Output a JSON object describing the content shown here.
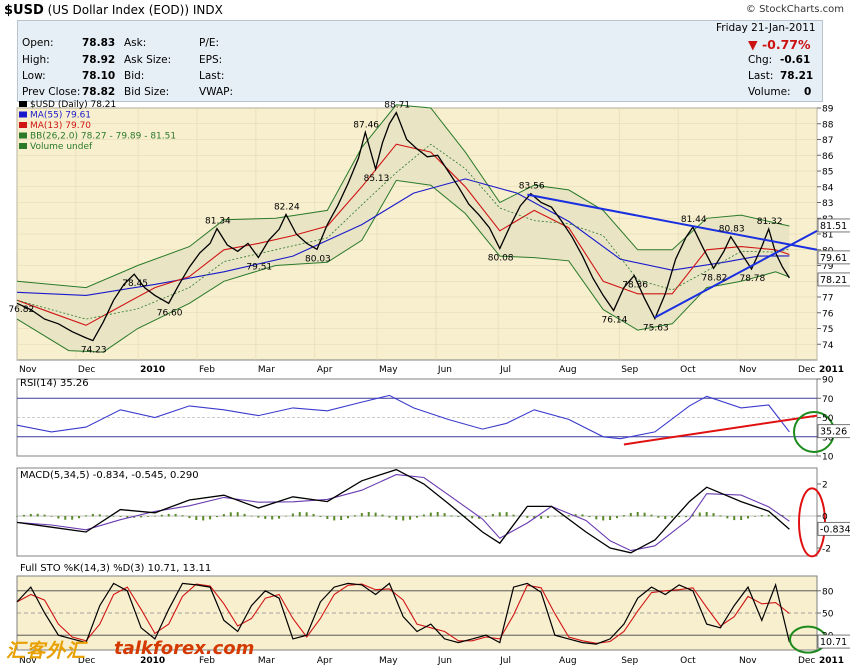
{
  "header": {
    "symbol": "$USD",
    "name": "(US Dollar Index (EOD))",
    "exchange": "INDX",
    "brand": "© StockCharts.com"
  },
  "quote": {
    "date": "Friday   21-Jan-2011",
    "pct_change": "▼ -0.77%",
    "open_label": "Open:",
    "open": "78.83",
    "high_label": "High:",
    "high": "78.92",
    "low_label": "Low:",
    "low": "78.10",
    "prev_label": "Prev Close:",
    "prev": "78.82",
    "ask_label": "Ask:",
    "asksize_label": "Ask Size:",
    "bid_label": "Bid:",
    "bidsize_label": "Bid Size:",
    "pe_label": "P/E:",
    "eps_label": "EPS:",
    "last_label": "Last:",
    "vwap_label": "VWAP:",
    "chg_label": "Chg:",
    "chg": "-0.61",
    "last2_label": "Last:",
    "last2": "78.21",
    "vol_label": "Volume:",
    "vol": "0"
  },
  "chart_data": [
    {
      "type": "line",
      "title": "$USD (Daily) 78.21",
      "legend": [
        "$USD (Daily) 78.21",
        "MA(55) 79.61",
        "MA(13) 79.70",
        "BB(26,2.0) 78.27 - 79.89 - 81.51",
        "Volume undef"
      ],
      "x": [
        "Nov",
        "Dec",
        "2010",
        "Feb",
        "Mar",
        "Apr",
        "May",
        "Jun",
        "Jul",
        "Aug",
        "Sep",
        "Oct",
        "Nov",
        "Dec",
        "2011"
      ],
      "ylim": [
        73,
        89
      ],
      "yticks": [
        74,
        75,
        76,
        77,
        78,
        79,
        80,
        81,
        82,
        83,
        84,
        85,
        86,
        87,
        88,
        89
      ],
      "price_path": [
        [
          0,
          76.6
        ],
        [
          4,
          76.2
        ],
        [
          8,
          75.6
        ],
        [
          12,
          75.3
        ],
        [
          16,
          74.8
        ],
        [
          20,
          74.4
        ],
        [
          22,
          74.23
        ],
        [
          25,
          75.4
        ],
        [
          28,
          76.8
        ],
        [
          31,
          77.8
        ],
        [
          34,
          78.45
        ],
        [
          37,
          77.6
        ],
        [
          40,
          77.1
        ],
        [
          44,
          76.6
        ],
        [
          47,
          77.8
        ],
        [
          50,
          78.9
        ],
        [
          53,
          79.8
        ],
        [
          56,
          80.4
        ],
        [
          58,
          81.34
        ],
        [
          61,
          80.3
        ],
        [
          64,
          79.9
        ],
        [
          67,
          80.4
        ],
        [
          70,
          79.51
        ],
        [
          73,
          80.6
        ],
        [
          76,
          81.3
        ],
        [
          78,
          82.24
        ],
        [
          81,
          81.0
        ],
        [
          84,
          80.4
        ],
        [
          87,
          80.03
        ],
        [
          90,
          81.6
        ],
        [
          93,
          82.8
        ],
        [
          96,
          84.2
        ],
        [
          99,
          85.8
        ],
        [
          101,
          87.46
        ],
        [
          104,
          85.13
        ],
        [
          106,
          86.8
        ],
        [
          108,
          88.0
        ],
        [
          110,
          88.71
        ],
        [
          113,
          87.0
        ],
        [
          116,
          86.4
        ],
        [
          119,
          85.9
        ],
        [
          122,
          86.0
        ],
        [
          125,
          85.0
        ],
        [
          128,
          84.0
        ],
        [
          131,
          82.9
        ],
        [
          134,
          82.2
        ],
        [
          137,
          81.4
        ],
        [
          140,
          80.08
        ],
        [
          143,
          81.5
        ],
        [
          146,
          82.8
        ],
        [
          149,
          83.56
        ],
        [
          152,
          83.0
        ],
        [
          155,
          82.7
        ],
        [
          158,
          81.8
        ],
        [
          161,
          80.8
        ],
        [
          164,
          79.6
        ],
        [
          167,
          78.2
        ],
        [
          170,
          77.1
        ],
        [
          173,
          76.14
        ],
        [
          176,
          77.6
        ],
        [
          179,
          78.36
        ],
        [
          182,
          76.9
        ],
        [
          185,
          75.63
        ],
        [
          188,
          77.2
        ],
        [
          191,
          79.4
        ],
        [
          194,
          80.8
        ],
        [
          196,
          81.44
        ],
        [
          199,
          80.1
        ],
        [
          202,
          78.82
        ],
        [
          205,
          79.9
        ],
        [
          207,
          80.83
        ],
        [
          210,
          79.8
        ],
        [
          213,
          78.78
        ],
        [
          216,
          80.2
        ],
        [
          218,
          81.32
        ],
        [
          220,
          79.8
        ],
        [
          222,
          78.9
        ],
        [
          224,
          78.21
        ]
      ],
      "ma55_path": [
        [
          0,
          77.3
        ],
        [
          20,
          77.1
        ],
        [
          40,
          77.8
        ],
        [
          60,
          78.6
        ],
        [
          80,
          79.6
        ],
        [
          100,
          81.6
        ],
        [
          115,
          83.6
        ],
        [
          130,
          84.5
        ],
        [
          145,
          83.6
        ],
        [
          160,
          81.8
        ],
        [
          175,
          79.4
        ],
        [
          190,
          78.7
        ],
        [
          205,
          79.2
        ],
        [
          215,
          79.6
        ],
        [
          224,
          79.61
        ]
      ],
      "ma13_path": [
        [
          0,
          76.8
        ],
        [
          10,
          76.0
        ],
        [
          20,
          75.2
        ],
        [
          30,
          76.4
        ],
        [
          40,
          77.6
        ],
        [
          50,
          78.3
        ],
        [
          60,
          80.0
        ],
        [
          70,
          80.4
        ],
        [
          80,
          80.9
        ],
        [
          90,
          81.5
        ],
        [
          100,
          84.0
        ],
        [
          110,
          86.7
        ],
        [
          120,
          86.2
        ],
        [
          130,
          84.0
        ],
        [
          140,
          81.2
        ],
        [
          150,
          82.5
        ],
        [
          160,
          81.4
        ],
        [
          170,
          78.0
        ],
        [
          180,
          77.2
        ],
        [
          190,
          77.2
        ],
        [
          200,
          80.0
        ],
        [
          210,
          80.2
        ],
        [
          220,
          80.0
        ],
        [
          224,
          79.7
        ]
      ],
      "bb_upper_path": [
        [
          0,
          78.0
        ],
        [
          20,
          77.6
        ],
        [
          35,
          79.0
        ],
        [
          50,
          80.2
        ],
        [
          60,
          81.9
        ],
        [
          75,
          82.0
        ],
        [
          90,
          82.5
        ],
        [
          100,
          86.5
        ],
        [
          110,
          89.2
        ],
        [
          120,
          89.0
        ],
        [
          130,
          86.2
        ],
        [
          140,
          83.0
        ],
        [
          150,
          84.1
        ],
        [
          160,
          83.8
        ],
        [
          170,
          82.5
        ],
        [
          180,
          80.0
        ],
        [
          190,
          80.0
        ],
        [
          200,
          82.0
        ],
        [
          210,
          82.2
        ],
        [
          220,
          81.7
        ],
        [
          224,
          81.51
        ]
      ],
      "bb_lower_path": [
        [
          0,
          75.6
        ],
        [
          15,
          73.6
        ],
        [
          25,
          73.5
        ],
        [
          35,
          75.0
        ],
        [
          50,
          76.6
        ],
        [
          60,
          78.0
        ],
        [
          75,
          79.0
        ],
        [
          90,
          79.2
        ],
        [
          100,
          80.6
        ],
        [
          110,
          84.4
        ],
        [
          120,
          84.1
        ],
        [
          130,
          82.3
        ],
        [
          140,
          79.6
        ],
        [
          150,
          79.5
        ],
        [
          160,
          79.3
        ],
        [
          170,
          76.2
        ],
        [
          180,
          74.9
        ],
        [
          190,
          75.3
        ],
        [
          200,
          77.6
        ],
        [
          210,
          78.0
        ],
        [
          220,
          78.6
        ],
        [
          224,
          78.27
        ]
      ],
      "annotations": [
        {
          "label": "76.82",
          "x": 1,
          "y": 76.82
        },
        {
          "label": "74.23",
          "x": 22,
          "y": 74.23
        },
        {
          "label": "78.45",
          "x": 34,
          "y": 78.45
        },
        {
          "label": "76.60",
          "x": 44,
          "y": 76.6
        },
        {
          "label": "81.34",
          "x": 58,
          "y": 81.34
        },
        {
          "label": "79.51",
          "x": 70,
          "y": 79.51
        },
        {
          "label": "82.24",
          "x": 78,
          "y": 82.24
        },
        {
          "label": "80.03",
          "x": 87,
          "y": 80.03
        },
        {
          "label": "87.46",
          "x": 101,
          "y": 87.46
        },
        {
          "label": "85.13",
          "x": 104,
          "y": 85.13
        },
        {
          "label": "88.71",
          "x": 110,
          "y": 88.71
        },
        {
          "label": "80.08",
          "x": 140,
          "y": 80.08
        },
        {
          "label": "83.56",
          "x": 149,
          "y": 83.56
        },
        {
          "label": "76.14",
          "x": 173,
          "y": 76.14
        },
        {
          "label": "78.36",
          "x": 179,
          "y": 78.36
        },
        {
          "label": "75.63",
          "x": 185,
          "y": 75.63
        },
        {
          "label": "81.44",
          "x": 196,
          "y": 81.44
        },
        {
          "label": "78.82",
          "x": 202,
          "y": 78.82
        },
        {
          "label": "80.83",
          "x": 207,
          "y": 80.83
        },
        {
          "label": "78.78",
          "x": 213,
          "y": 78.78
        },
        {
          "label": "81.32",
          "x": 218,
          "y": 81.32
        }
      ],
      "right_labels": [
        "81.51",
        "79.61",
        "78.21"
      ],
      "trendlines": [
        {
          "from": [
            148,
            83.5
          ],
          "to": [
            232,
            80.0
          ]
        },
        {
          "from": [
            185,
            75.7
          ],
          "to": [
            232,
            81.2
          ]
        }
      ]
    },
    {
      "type": "line",
      "title": "RSI(14) 35.26",
      "ylim": [
        10,
        90
      ],
      "yticks": [
        10,
        30,
        50,
        70,
        90
      ],
      "ref_lines": [
        30,
        70
      ],
      "last": "35.26",
      "path": [
        [
          0,
          42
        ],
        [
          10,
          35
        ],
        [
          20,
          40
        ],
        [
          30,
          58
        ],
        [
          40,
          50
        ],
        [
          50,
          62
        ],
        [
          60,
          58
        ],
        [
          70,
          52
        ],
        [
          80,
          60
        ],
        [
          90,
          57
        ],
        [
          100,
          66
        ],
        [
          108,
          73
        ],
        [
          115,
          60
        ],
        [
          125,
          48
        ],
        [
          135,
          38
        ],
        [
          142,
          44
        ],
        [
          150,
          58
        ],
        [
          160,
          48
        ],
        [
          170,
          30
        ],
        [
          175,
          28
        ],
        [
          185,
          35
        ],
        [
          195,
          62
        ],
        [
          200,
          72
        ],
        [
          210,
          60
        ],
        [
          218,
          63
        ],
        [
          224,
          35
        ]
      ],
      "trendline": {
        "from": [
          176,
          22
        ],
        "to": [
          232,
          52
        ]
      }
    },
    {
      "type": "line",
      "title": "MACD(5,34,5) -0.834, -0.545, 0.290",
      "series": [
        {
          "name": "MACD(5,34,5)"
        },
        {
          "name": "Signal"
        },
        {
          "name": "Histogram"
        }
      ],
      "ylim": [
        -2.5,
        3
      ],
      "yticks": [
        -2,
        0,
        2
      ],
      "last": "-0.834",
      "path": [
        [
          0,
          -0.4
        ],
        [
          10,
          -0.7
        ],
        [
          20,
          -1.0
        ],
        [
          30,
          0.4
        ],
        [
          40,
          0.2
        ],
        [
          50,
          1.0
        ],
        [
          60,
          1.3
        ],
        [
          70,
          0.5
        ],
        [
          80,
          1.2
        ],
        [
          90,
          0.9
        ],
        [
          100,
          2.2
        ],
        [
          110,
          2.9
        ],
        [
          118,
          2.0
        ],
        [
          125,
          0.8
        ],
        [
          135,
          -1.0
        ],
        [
          140,
          -1.7
        ],
        [
          148,
          0.6
        ],
        [
          155,
          0.6
        ],
        [
          165,
          -1.0
        ],
        [
          172,
          -2.0
        ],
        [
          178,
          -2.3
        ],
        [
          185,
          -1.5
        ],
        [
          195,
          0.9
        ],
        [
          200,
          1.8
        ],
        [
          210,
          0.9
        ],
        [
          218,
          0.3
        ],
        [
          224,
          -0.834
        ]
      ]
    },
    {
      "type": "line",
      "title": "Full STO %K(14,3) %D(3) 10.71, 13.11",
      "ylim": [
        0,
        100
      ],
      "yticks": [
        20,
        50,
        80
      ],
      "ref_lines": [
        20,
        50,
        80
      ],
      "last": "10.71",
      "path": [
        [
          0,
          65
        ],
        [
          4,
          85
        ],
        [
          8,
          50
        ],
        [
          12,
          20
        ],
        [
          16,
          15
        ],
        [
          20,
          10
        ],
        [
          24,
          60
        ],
        [
          28,
          90
        ],
        [
          32,
          80
        ],
        [
          36,
          30
        ],
        [
          40,
          15
        ],
        [
          44,
          55
        ],
        [
          48,
          90
        ],
        [
          52,
          88
        ],
        [
          56,
          85
        ],
        [
          60,
          40
        ],
        [
          64,
          25
        ],
        [
          68,
          60
        ],
        [
          72,
          80
        ],
        [
          76,
          70
        ],
        [
          80,
          15
        ],
        [
          84,
          20
        ],
        [
          88,
          65
        ],
        [
          92,
          85
        ],
        [
          96,
          90
        ],
        [
          100,
          88
        ],
        [
          104,
          75
        ],
        [
          108,
          90
        ],
        [
          112,
          45
        ],
        [
          116,
          25
        ],
        [
          120,
          35
        ],
        [
          124,
          15
        ],
        [
          128,
          10
        ],
        [
          132,
          15
        ],
        [
          136,
          20
        ],
        [
          140,
          10
        ],
        [
          144,
          85
        ],
        [
          148,
          90
        ],
        [
          152,
          78
        ],
        [
          156,
          20
        ],
        [
          160,
          15
        ],
        [
          164,
          10
        ],
        [
          168,
          8
        ],
        [
          172,
          15
        ],
        [
          176,
          35
        ],
        [
          180,
          70
        ],
        [
          184,
          85
        ],
        [
          188,
          75
        ],
        [
          192,
          88
        ],
        [
          196,
          80
        ],
        [
          200,
          35
        ],
        [
          204,
          30
        ],
        [
          208,
          60
        ],
        [
          212,
          85
        ],
        [
          216,
          40
        ],
        [
          220,
          88
        ],
        [
          224,
          10.71
        ]
      ]
    }
  ]
}
